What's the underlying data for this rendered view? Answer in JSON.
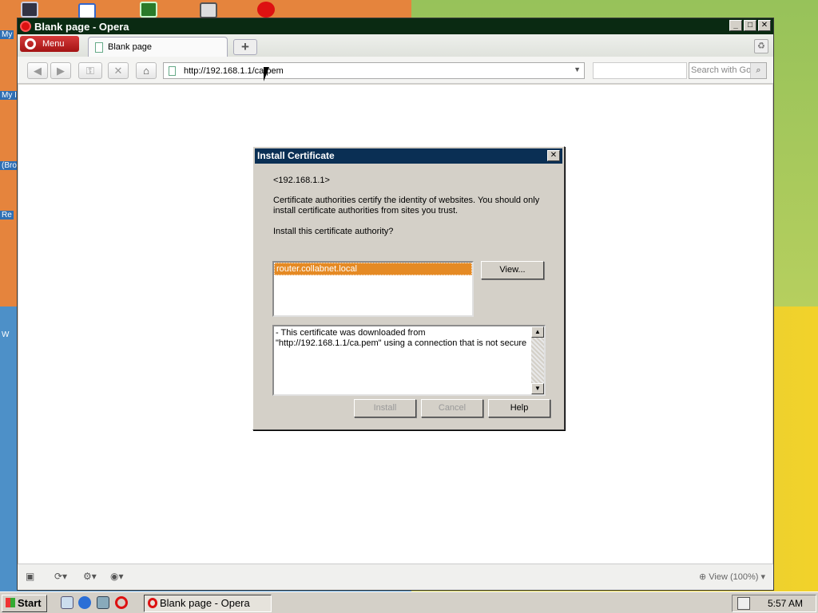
{
  "desktop": {
    "side_labels": [
      "My",
      "My I",
      "(Bro",
      "Re",
      "W"
    ]
  },
  "window": {
    "title": "Blank page - Opera",
    "controls": {
      "minimize": "_",
      "maximize": "□",
      "close": "✕"
    },
    "menu_label": "Menu",
    "tab_label": "Blank page",
    "new_tab": "+",
    "address": "http://192.168.1.1/ca.pem",
    "search_placeholder": "Search with Go",
    "status_zoom": "View (100%)"
  },
  "dialog": {
    "title": "Install Certificate",
    "host": "<192.168.1.1>",
    "description": "Certificate authorities certify the identity of websites. You should only install certificate authorities from sites you trust.",
    "question": "Install this certificate authority?",
    "list_items": [
      "router.collabnet.local"
    ],
    "view_button": "View...",
    "details": "- This certificate was downloaded from \"http://192.168.1.1/ca.pem\" using a connection that is not secure",
    "install_button": "Install",
    "cancel_button": "Cancel",
    "help_button": "Help"
  },
  "taskbar": {
    "start_label": "Start",
    "active_window": "Blank page - Opera",
    "clock": "5:57 AM"
  },
  "colors": {
    "titlebar": "#0a2a12",
    "dialog_title": "#0a2f54",
    "selection": "#e58a24"
  }
}
